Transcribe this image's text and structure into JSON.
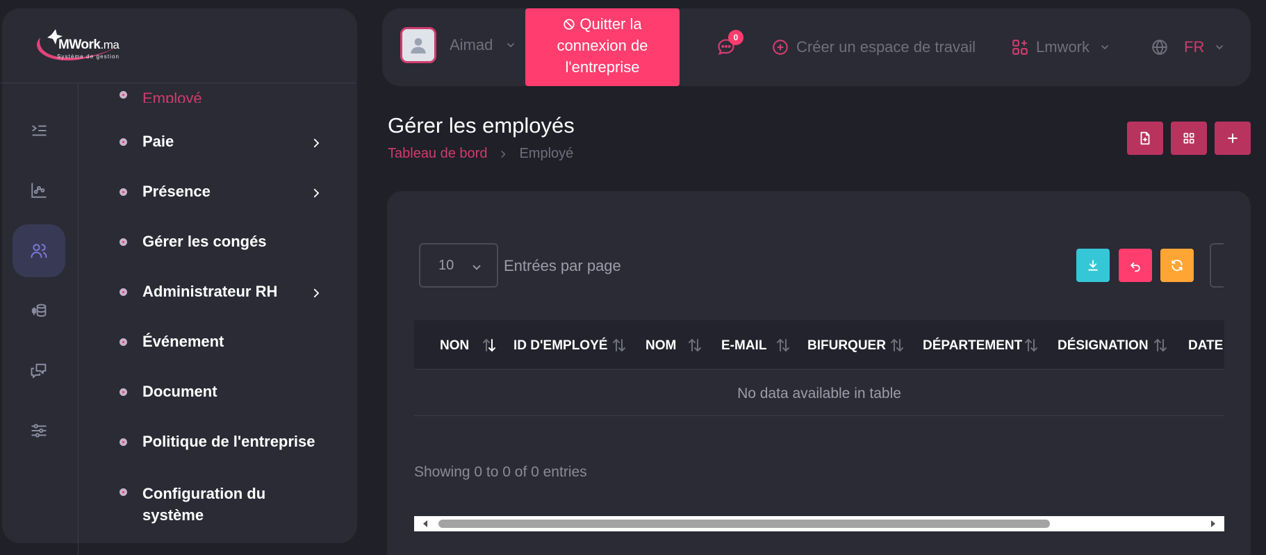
{
  "brand": {
    "name_main": "MWork",
    "name_suffix": ".ma",
    "tagline": "Système de gestion",
    "accent": "#d03c6e"
  },
  "rail": [
    {
      "icon": "collapse-menu-icon"
    },
    {
      "icon": "analytics-icon"
    },
    {
      "icon": "users-icon",
      "active": true
    },
    {
      "icon": "finance-icon"
    },
    {
      "icon": "messages-icon"
    },
    {
      "icon": "settings-sliders-icon"
    }
  ],
  "sidebar": {
    "items": [
      {
        "label": "Employé"
      },
      {
        "label": "Paie",
        "has_submenu": true
      },
      {
        "label": "Présence",
        "has_submenu": true
      },
      {
        "label": "Gérer les congés"
      },
      {
        "label": "Administrateur RH",
        "has_submenu": true
      },
      {
        "label": "Événement"
      },
      {
        "label": "Document"
      },
      {
        "label": "Politique de l'entreprise"
      },
      {
        "label": "Configuration du",
        "label_line2": "système"
      }
    ]
  },
  "header": {
    "user_name": "Aimad",
    "quit_label_1": "Quitter la",
    "quit_label_2": "connexion de",
    "quit_label_3": "l'entreprise",
    "chat_count": "0",
    "create_workspace": "Créer un espace de travail",
    "workspace": "Lmwork",
    "language": "FR"
  },
  "page": {
    "title": "Gérer les employés",
    "breadcrumb_home": "Tableau de bord",
    "breadcrumb_current": "Employé"
  },
  "table": {
    "page_size": "10",
    "entries_label": "Entrées par page",
    "columns": [
      "NON",
      "ID D'EMPLOYÉ",
      "NOM",
      "E-MAIL",
      "BIFURQUER",
      "DÉPARTEMENT",
      "DÉSIGNATION",
      "DATE"
    ],
    "empty_message": "No data available in table",
    "showing": "Showing 0 to 0 of 0 entries"
  },
  "colors": {
    "background": "#1f2028",
    "panel": "#2a2b35",
    "accent_pink": "#ff3d6e",
    "export_teal": "#35c7d8",
    "reset_orange": "#ffa534"
  }
}
